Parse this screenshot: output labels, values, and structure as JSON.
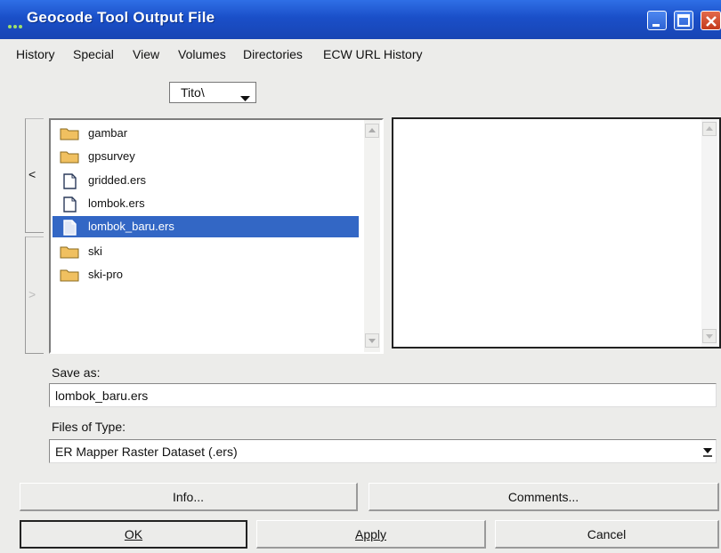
{
  "window": {
    "title": "Geocode Tool Output File"
  },
  "menu": [
    {
      "label": "History"
    },
    {
      "label": "Special"
    },
    {
      "label": "View"
    },
    {
      "label": "Volumes"
    },
    {
      "label": "Directories"
    },
    {
      "label": "ECW URL History"
    }
  ],
  "directory": {
    "selected": "Tito\\"
  },
  "nav": {
    "up_glyph": "<",
    "down_glyph": ">"
  },
  "files": [
    {
      "name": "gambar",
      "icon": "folder-icon"
    },
    {
      "name": "gpsurvey",
      "icon": "folder-icon"
    },
    {
      "name": "gridded.ers",
      "icon": "file-icon"
    },
    {
      "name": "lombok.ers",
      "icon": "file-icon"
    },
    {
      "name": "lombok_baru.ers",
      "icon": "file-icon",
      "selected": true
    },
    {
      "name": "ski",
      "icon": "folder-icon"
    },
    {
      "name": "ski-pro",
      "icon": "folder-icon"
    }
  ],
  "save_as": {
    "label": "Save as:",
    "value": "lombok_baru.ers"
  },
  "file_type": {
    "label": "Files of Type:",
    "value": "ER Mapper Raster Dataset (.ers)"
  },
  "buttons": {
    "info": "Info...",
    "comments": "Comments...",
    "ok": "OK",
    "apply": "Apply",
    "cancel": "Cancel"
  },
  "colors": {
    "titlebar": "#1a4fc8",
    "selection": "#3367c5",
    "folder": "#f0c060"
  }
}
